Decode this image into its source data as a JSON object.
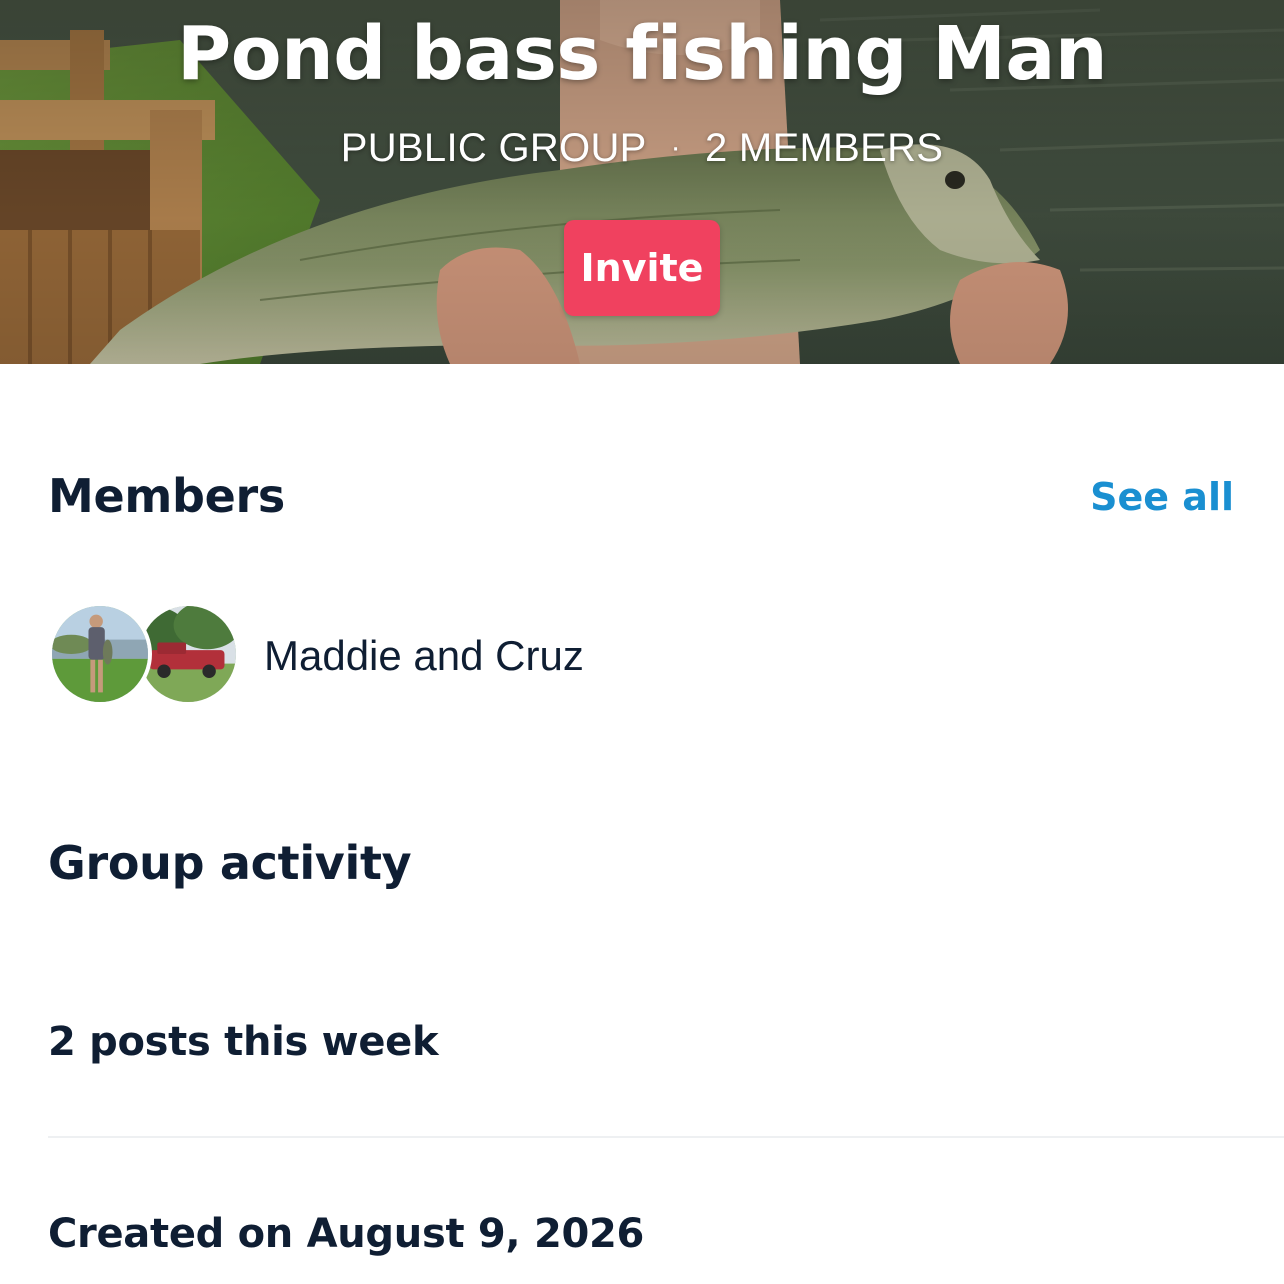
{
  "group": {
    "title": "Pond bass fishing Man",
    "visibility": "PUBLIC GROUP",
    "separator": "·",
    "member_count": "2 MEMBERS",
    "invite_label": "Invite"
  },
  "members": {
    "title": "Members",
    "see_all_label": "See all",
    "names": "Maddie and Cruz"
  },
  "activity": {
    "title": "Group activity",
    "posts_this_week": "2 posts this week",
    "created_on": "Created on August 9, 2026"
  },
  "colors": {
    "invite_button": "#f0415f",
    "link": "#1a8fd1",
    "text_dark": "#0f1e33"
  }
}
